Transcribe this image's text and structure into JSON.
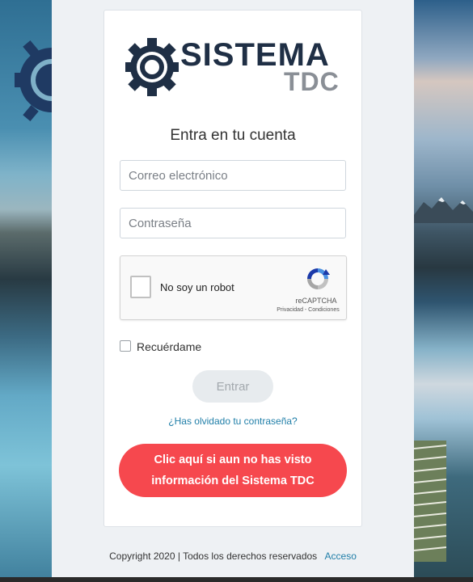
{
  "brand": {
    "name_line1": "SISTEMA",
    "name_line2": "TDC"
  },
  "login": {
    "title": "Entra en tu cuenta",
    "email_placeholder": "Correo electrónico",
    "password_placeholder": "Contraseña",
    "remember_label": "Recuérdame",
    "submit_label": "Entrar",
    "forgot_link": "¿Has olvidado tu contraseña?"
  },
  "recaptcha": {
    "label": "No soy un robot",
    "brand": "reCAPTCHA",
    "links": "Privacidad - Condiciones"
  },
  "cta": {
    "label": "Clic aquí si aun no has visto información del Sistema TDC"
  },
  "footer": {
    "copyright": "Copyright 2020 | Todos los derechos reservados",
    "link": "Acceso"
  },
  "colors": {
    "cta": "#f6484e",
    "link": "#1f7ea8",
    "brand_dark": "#1f2f45",
    "brand_gray": "#8a8f96"
  },
  "icons": {
    "logo": "gear-icon",
    "recaptcha": "recaptcha-icon"
  }
}
